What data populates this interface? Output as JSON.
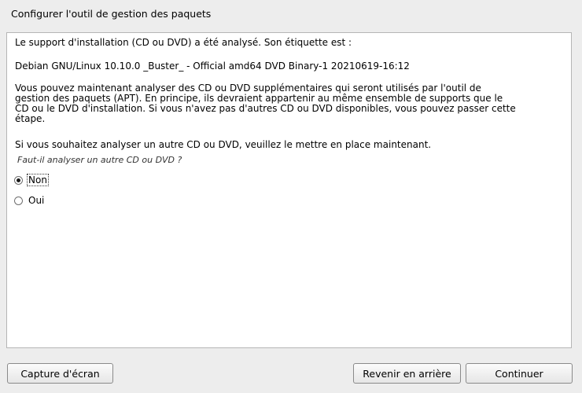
{
  "header": {
    "title": "Configurer l'outil de gestion des paquets"
  },
  "content": {
    "intro": "Le support d'installation (CD ou DVD) a été analysé. Son étiquette est :",
    "disc_label": "Debian GNU/Linux 10.10.0 _Buster_ - Official amd64 DVD Binary-1 20210619-16:12",
    "description": "Vous pouvez maintenant analyser des CD ou DVD supplémentaires qui seront utilisés par l'outil de\ngestion des paquets (APT). En principe, ils devraient appartenir au même ensemble de supports que le\nCD ou le DVD d'installation. Si vous n'avez pas d'autres CD ou DVD disponibles, vous pouvez passer cette\nétape.",
    "instruction": "Si vous souhaitez analyser un autre CD ou DVD, veuillez le mettre en place maintenant.",
    "question": "Faut-il analyser un autre CD ou DVD ?",
    "options": [
      {
        "label": "Non",
        "selected": true
      },
      {
        "label": "Oui",
        "selected": false
      }
    ]
  },
  "buttons": {
    "screenshot": "Capture d'écran",
    "back": "Revenir en arrière",
    "continue": "Continuer"
  }
}
